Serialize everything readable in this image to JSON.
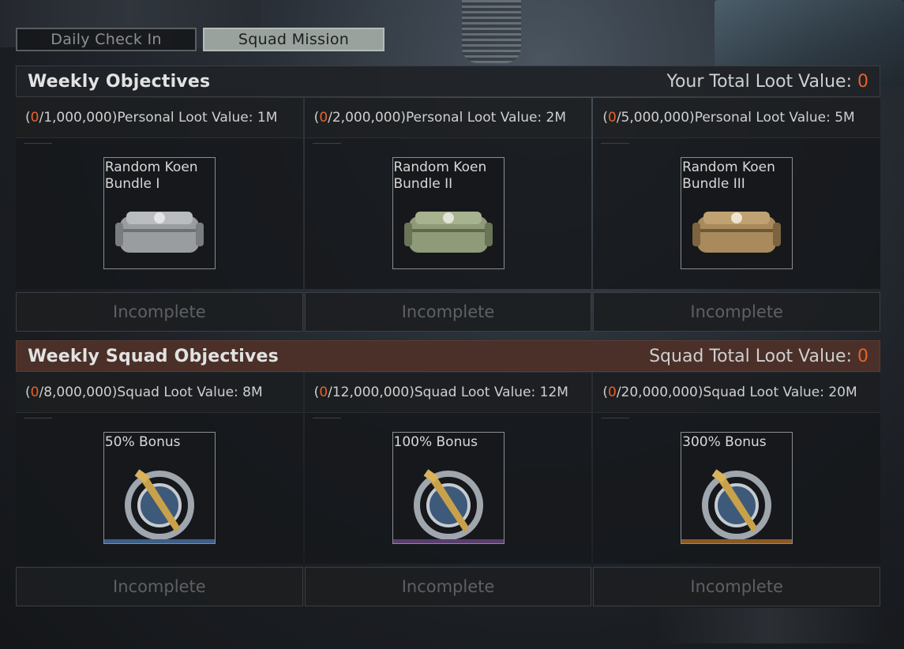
{
  "tabs": [
    {
      "label": "Daily Check In",
      "active": false
    },
    {
      "label": "Squad Mission",
      "active": true
    }
  ],
  "weekly": {
    "title": "Weekly Objectives",
    "total_label": "Your Total Loot Value: ",
    "total_value": "0",
    "objectives": [
      {
        "progress": "0",
        "target": "/1,000,000)",
        "desc": "Personal Loot Value: 1M",
        "reward": "Random Koen Bundle I",
        "status": "Incomplete",
        "color": "#9a9da0",
        "icon": "gray-duffel-bag-icon"
      },
      {
        "progress": "0",
        "target": "/2,000,000)",
        "desc": "Personal Loot Value: 2M",
        "reward": "Random Koen Bundle II",
        "status": "Incomplete",
        "color": "#8e9a78",
        "icon": "green-duffel-bag-icon"
      },
      {
        "progress": "0",
        "target": "/5,000,000)",
        "desc": "Personal Loot Value: 5M",
        "reward": "Random Koen Bundle III",
        "status": "Incomplete",
        "color": "#a88a5c",
        "icon": "tan-duffel-bag-icon"
      }
    ]
  },
  "squad": {
    "title": "Weekly Squad Objectives",
    "total_label": "Squad Total Loot Value: ",
    "total_value": "0",
    "objectives": [
      {
        "progress": "0",
        "target": "/8,000,000)",
        "desc": "Squad Loot Value: 8M",
        "reward": "50% Bonus",
        "status": "Incomplete",
        "rarity": "#3d5f88",
        "icon": "dagger-badge-icon"
      },
      {
        "progress": "0",
        "target": "/12,000,000)",
        "desc": "Squad Loot Value: 12M",
        "reward": "100% Bonus",
        "status": "Incomplete",
        "rarity": "#5a3d6e",
        "icon": "dagger-badge-icon"
      },
      {
        "progress": "0",
        "target": "/20,000,000)",
        "desc": "Squad Loot Value: 20M",
        "reward": "300% Bonus",
        "status": "Incomplete",
        "rarity": "#8a5a22",
        "icon": "dagger-badge-icon"
      }
    ]
  },
  "colors": {
    "accent": "#e8622a",
    "squad_header": "#4a3028"
  }
}
